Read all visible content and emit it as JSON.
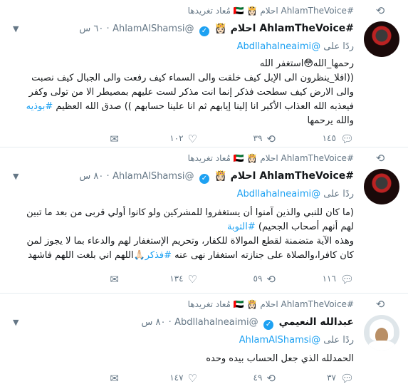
{
  "retweeted_by": "#AhlamTheVoice احلام 👸🏻 🇦🇪 مُعاد تغريدها",
  "tweets": [
    {
      "name": "#AhlamTheVoice احلام 👸🏻",
      "handle": "@AhlamAlShamsi",
      "time": "٦٠ س",
      "reply_label": "ردًا على",
      "reply_to": "@Abdllahalneaimi",
      "lines": [
        "رحمها_الله😳استغفر الله",
        "((افلا_ينظرون الى الإبل كيف خلقت والى السماء كيف رفعت والى الجبال كيف نصبت",
        "والى الارض كيف سطحت فذكر إنما انت مذكر لست عليهم بمصيطر الا من تولى وكفر",
        "فيعذبه الله العذاب الأكبر انا إلينا إيابهم ثم انا علينا حسابهم )) صدق الله العظيم #بوذيه",
        "والله يرحمها"
      ],
      "replies": "١٤٥",
      "retweets": "٣٩",
      "likes": "١٠٢"
    },
    {
      "name": "#AhlamTheVoice احلام 👸🏻",
      "handle": "@AhlamAlShamsi",
      "time": "٨٠ س",
      "reply_label": "ردًا على",
      "reply_to": "@Abdllahalneaimi",
      "lines": [
        "(ما كان للنبي والذين آمنوا أن يستغفروا للمشركين ولو كانوا أولي قربى من بعد ما تبين",
        "لهم أنهم أصحاب الجحيم) #التوبة",
        "وهذه الآية متضمنة لقطع الموالاة للكفار، وتحريم الإستغفار لهم والدعاء بما لا يجوز لمن",
        "كان كافرا،والصلاة على جنازته استغفار نهى عنه #فذكر🙏🏻اللهم اني بلغت اللهم فاشهد"
      ],
      "replies": "١١٦",
      "retweets": "٥٩",
      "likes": "١٣٤"
    },
    {
      "name": "عبدالله النعيمي",
      "handle": "@Abdllahalneaimi",
      "time": "٨٠ س",
      "reply_label": "ردًا على",
      "reply_to": "@AhlamAlShamsi",
      "lines": [
        "الحمدلله الذي جعل الحساب بيده وحده"
      ],
      "replies": "٣٧",
      "retweets": "٤٩",
      "likes": "١٤٧"
    }
  ],
  "icons": {
    "retweet": "retweet-icon",
    "reply": "reply-icon",
    "like": "heart-icon",
    "dm": "envelope-icon",
    "caret": "chevron-down-icon"
  },
  "colors": {
    "link": "#1da1f2",
    "muted": "#657786",
    "verified": "#1da1f2"
  }
}
